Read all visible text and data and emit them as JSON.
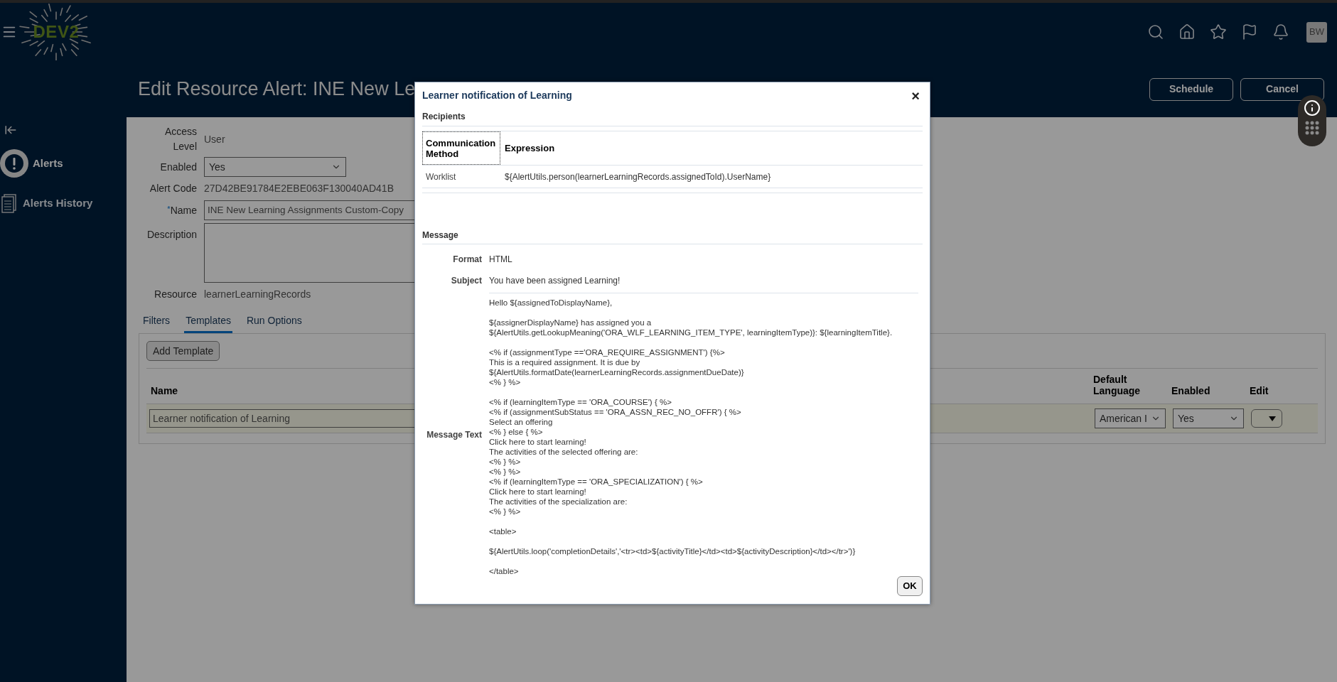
{
  "header": {
    "logo_text": "DEV2",
    "avatar": "BW"
  },
  "page": {
    "title": "Edit Resource Alert: INE New Le",
    "actions": [
      {
        "label": "Schedule"
      },
      {
        "label": "Cancel"
      }
    ]
  },
  "sidebar": {
    "items": [
      {
        "label": "Alerts",
        "kind": "alert",
        "selected": true
      },
      {
        "label": "Alerts History",
        "kind": "history",
        "selected": false
      }
    ]
  },
  "form": {
    "fields": [
      {
        "label": "Access Level",
        "kind": "text",
        "value": "User"
      },
      {
        "label": "Enabled",
        "kind": "select",
        "value": "Yes"
      },
      {
        "label": "Alert Code",
        "kind": "text",
        "value": "27D42BE91784E2EBE063F130040AD41B"
      },
      {
        "label": "Name",
        "kind": "input",
        "required_mark": "*",
        "value": "INE New Learning Assignments Custom-Copy"
      },
      {
        "label": "Description",
        "kind": "textarea"
      },
      {
        "label": "Resource",
        "kind": "text",
        "value": "learnerLearningRecords"
      }
    ]
  },
  "tabs": [
    {
      "label": "Filters",
      "selected": false
    },
    {
      "label": "Templates",
      "selected": true
    },
    {
      "label": "Run Options",
      "selected": false
    }
  ],
  "templates": {
    "add_button": "Add Template",
    "columns": [
      "Name",
      "Default Language",
      "Enabled",
      "Edit"
    ],
    "rows": [
      {
        "name": "Learner notification of Learning",
        "language": "American I",
        "enabled": "Yes",
        "selected": true
      }
    ]
  },
  "dialog": {
    "title": "Learner notification of Learning",
    "close": "×",
    "recipients": {
      "heading": "Recipients",
      "columns": [
        "Communication Method",
        "Expression"
      ],
      "rows": [
        {
          "method": "Worklist",
          "expression": "${AlertUtils.person(learnerLearningRecords.assignedToId).UserName}"
        }
      ]
    },
    "message": {
      "heading": "Message",
      "format_label": "Format",
      "format": "HTML",
      "subject_label": "Subject",
      "subject": "You have been assigned Learning!",
      "text_label": "Message Text",
      "paragraphs": [
        [
          "Hello ${assignedToDisplayName},"
        ],
        [
          "${assignerDisplayName} has assigned you a",
          "${AlertUtils.getLookupMeaning('ORA_WLF_LEARNING_ITEM_TYPE', learningItemType)}: ${learningItemTitle}."
        ],
        [
          "<% if (assignmentType =='ORA_REQUIRE_ASSIGNMENT') {%>",
          "This is a required assignment. It is due by",
          "${AlertUtils.formatDate(learnerLearningRecords.assignmentDueDate)}",
          "<% } %>"
        ],
        [
          "<% if (learningItemType == 'ORA_COURSE') { %>",
          "<% if (assignmentSubStatus == 'ORA_ASSN_REC_NO_OFFR') { %>",
          "Select an offering",
          "<% } else { %>",
          "Click here to start learning!",
          "The activities of the selected offering are:",
          "<% } %>",
          "<% } %>",
          "<% if (learningItemType == 'ORA_SPECIALIZATION') { %>",
          "Click here to start learning!",
          "The activities of the specialization are:",
          "<% } %>"
        ],
        [
          "<table>"
        ],
        [
          "${AlertUtils.loop('completionDetails','<tr><td>${activityTitle}</td><td>${activityDescription}</td></tr>')}"
        ],
        [
          "</table>"
        ]
      ]
    },
    "ok_button": "OK"
  }
}
